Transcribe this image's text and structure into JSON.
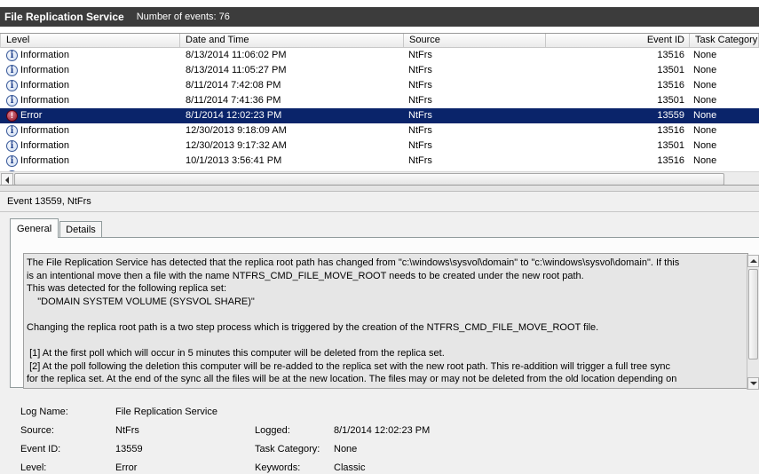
{
  "header": {
    "title": "File Replication Service",
    "event_count": "Number of events: 76"
  },
  "grid": {
    "columns": {
      "level": "Level",
      "date": "Date and Time",
      "source": "Source",
      "event_id": "Event ID",
      "task": "Task Category"
    },
    "rows": [
      {
        "icon": "info-icon",
        "level": "Information",
        "date": "8/13/2014 11:06:02 PM",
        "source": "NtFrs",
        "event_id": "13516",
        "task": "None"
      },
      {
        "icon": "info-icon",
        "level": "Information",
        "date": "8/13/2014 11:05:27 PM",
        "source": "NtFrs",
        "event_id": "13501",
        "task": "None"
      },
      {
        "icon": "info-icon",
        "level": "Information",
        "date": "8/11/2014 7:42:08 PM",
        "source": "NtFrs",
        "event_id": "13516",
        "task": "None"
      },
      {
        "icon": "info-icon",
        "level": "Information",
        "date": "8/11/2014 7:41:36 PM",
        "source": "NtFrs",
        "event_id": "13501",
        "task": "None"
      },
      {
        "icon": "error-icon",
        "level": "Error",
        "date": "8/1/2014 12:02:23 PM",
        "source": "NtFrs",
        "event_id": "13559",
        "task": "None"
      },
      {
        "icon": "info-icon",
        "level": "Information",
        "date": "12/30/2013 9:18:09 AM",
        "source": "NtFrs",
        "event_id": "13516",
        "task": "None"
      },
      {
        "icon": "info-icon",
        "level": "Information",
        "date": "12/30/2013 9:17:32 AM",
        "source": "NtFrs",
        "event_id": "13501",
        "task": "None"
      },
      {
        "icon": "info-icon",
        "level": "Information",
        "date": "10/1/2013 3:56:41 PM",
        "source": "NtFrs",
        "event_id": "13516",
        "task": "None"
      },
      {
        "icon": "info-icon",
        "level": "Information",
        "date": "",
        "source": "",
        "event_id": "",
        "task": ""
      }
    ]
  },
  "detail": {
    "title": "Event 13559, NtFrs",
    "tabs": [
      "General",
      "Details"
    ],
    "description": [
      "The File Replication Service has detected that the replica root path has changed from \"c:\\windows\\sysvol\\domain\" to \"c:\\windows\\sysvol\\domain\". If this",
      "is an intentional move then a file with the name NTFRS_CMD_FILE_MOVE_ROOT needs to be created under the new root path.",
      "This was detected for the following replica set:",
      "    \"DOMAIN SYSTEM VOLUME (SYSVOL SHARE)\"",
      "",
      "Changing the replica root path is a two step process which is triggered by the creation of the NTFRS_CMD_FILE_MOVE_ROOT file.",
      "",
      " [1] At the first poll which will occur in 5 minutes this computer will be deleted from the replica set.",
      " [2] At the poll following the deletion this computer will be re-added to the replica set with the new root path. This re-addition will trigger a full tree sync",
      "for the replica set. At the end of the sync all the files will be at the new location. The files may or may not be deleted from the old location depending on"
    ],
    "properties": {
      "log_name_label": "Log Name:",
      "log_name": "File Replication Service",
      "source_label": "Source:",
      "source": "NtFrs",
      "logged_label": "Logged:",
      "logged": "8/1/2014 12:02:23 PM",
      "event_id_label": "Event ID:",
      "event_id": "13559",
      "task_category_label": "Task Category:",
      "task_category": "None",
      "level_label": "Level:",
      "level": "Error",
      "keywords_label": "Keywords:",
      "keywords": "Classic"
    }
  },
  "colors": {
    "title_bar": "#3c3c3c",
    "selection": "#0a246a",
    "description_bg": "#e6e6e6"
  }
}
